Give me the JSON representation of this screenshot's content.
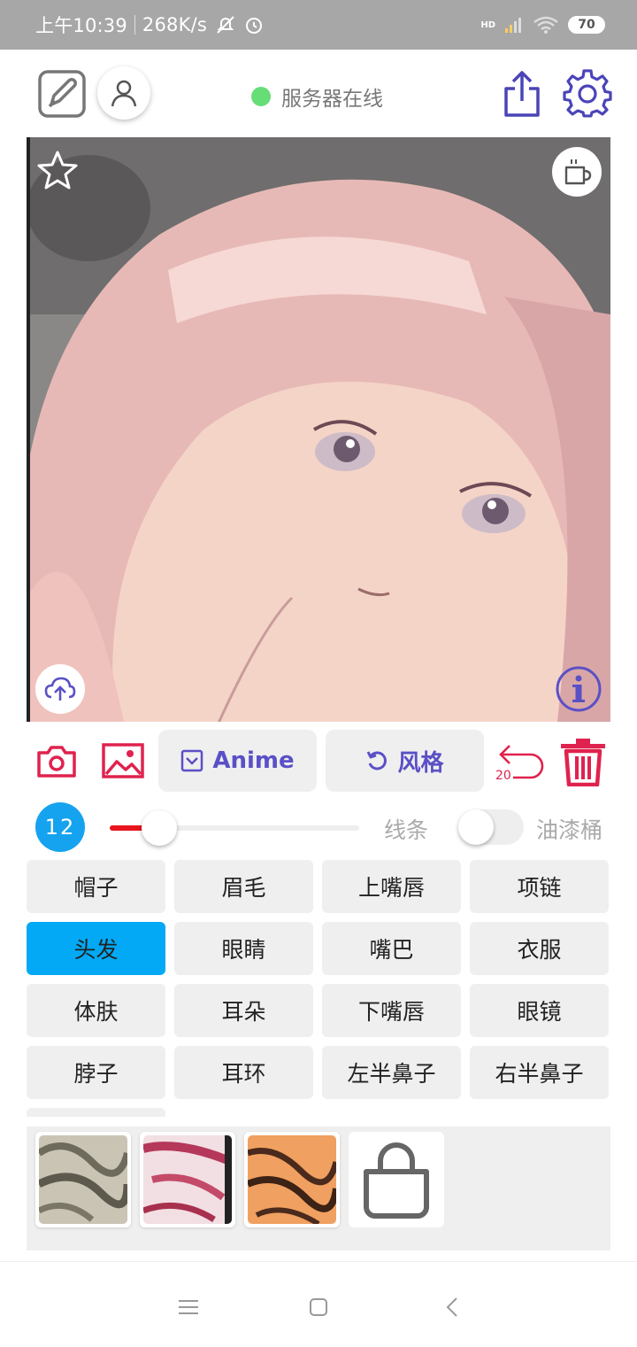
{
  "status_bar": {
    "time": "上午10:39",
    "speed": "268K/s",
    "network": "HD",
    "battery": "70"
  },
  "header": {
    "server_status": "服务器在线",
    "server_status_color": "#66dd77"
  },
  "toolbar": {
    "anime_label": "Anime",
    "style_label": "风格",
    "undo_count": "20",
    "accent_color": "#5a50c6",
    "danger_color": "#e0224e"
  },
  "brush": {
    "size": "12",
    "slider_level": 0.2,
    "line_label": "线条",
    "bucket_label": "油漆桶",
    "bucket_on": false
  },
  "parts": [
    {
      "label": "帽子",
      "selected": false
    },
    {
      "label": "眉毛",
      "selected": false
    },
    {
      "label": "上嘴唇",
      "selected": false
    },
    {
      "label": "项链",
      "selected": false
    },
    {
      "label": "头发",
      "selected": true
    },
    {
      "label": "眼睛",
      "selected": false
    },
    {
      "label": "嘴巴",
      "selected": false
    },
    {
      "label": "衣服",
      "selected": false
    },
    {
      "label": "体肤",
      "selected": false
    },
    {
      "label": "耳朵",
      "selected": false
    },
    {
      "label": "下嘴唇",
      "selected": false
    },
    {
      "label": "眼镜",
      "selected": false
    },
    {
      "label": "脖子",
      "selected": false
    },
    {
      "label": "耳环",
      "selected": false
    },
    {
      "label": "左半鼻子",
      "selected": false
    },
    {
      "label": "右半鼻子",
      "selected": false
    }
  ],
  "selected_color": "#03a9f4",
  "textures": [
    {
      "name": "gray-marble",
      "color": "#b8b3a3"
    },
    {
      "name": "pink-marble",
      "color": "#d98aa0"
    },
    {
      "name": "orange-stripes",
      "color": "#e88a4a"
    }
  ],
  "icons": [
    "edit-icon",
    "user-icon",
    "share-icon",
    "gear-icon",
    "star-icon",
    "coffee-icon",
    "upload-icon",
    "info-icon",
    "camera-icon",
    "image-icon",
    "anime-icon",
    "refresh-icon",
    "undo-icon",
    "trash-icon",
    "shopping-bag-icon",
    "menu-icon",
    "home-icon",
    "back-icon"
  ]
}
